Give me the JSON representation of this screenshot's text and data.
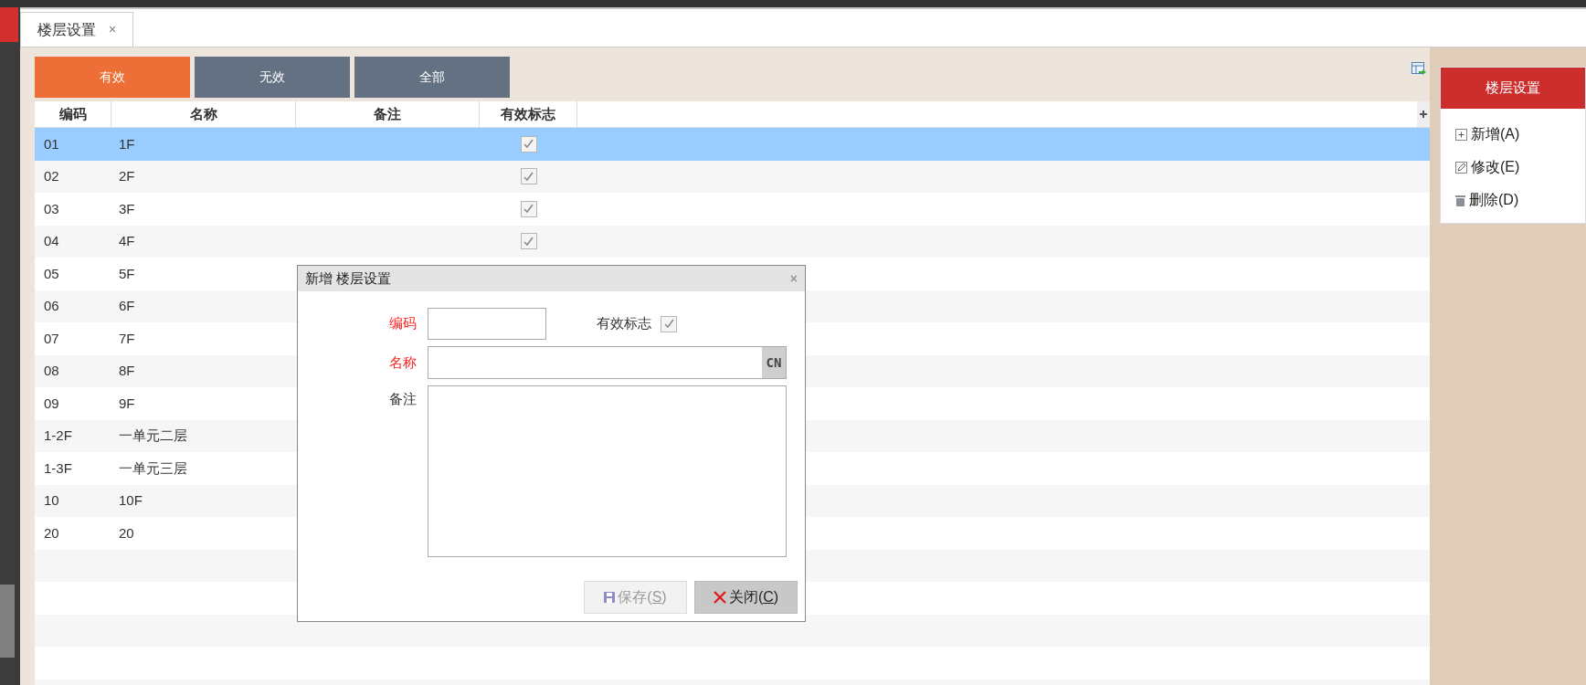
{
  "tab": {
    "label": "楼层设置",
    "close": "×"
  },
  "filters": [
    {
      "label": "有效",
      "selected": true
    },
    {
      "label": "无效",
      "selected": false
    },
    {
      "label": "全部",
      "selected": false
    }
  ],
  "table": {
    "columns": [
      "编码",
      "名称",
      "备注",
      "有效标志"
    ],
    "rows": [
      {
        "code": "01",
        "name": "1F",
        "selected": true,
        "valid": true
      },
      {
        "code": "02",
        "name": "2F",
        "selected": false,
        "valid": true
      },
      {
        "code": "03",
        "name": "3F",
        "selected": false,
        "valid": true
      },
      {
        "code": "04",
        "name": "4F",
        "selected": false,
        "valid": true
      },
      {
        "code": "05",
        "name": "5F",
        "selected": false
      },
      {
        "code": "06",
        "name": "6F",
        "selected": false
      },
      {
        "code": "07",
        "name": "7F",
        "selected": false
      },
      {
        "code": "08",
        "name": "8F",
        "selected": false
      },
      {
        "code": "09",
        "name": "9F",
        "selected": false
      },
      {
        "code": "1-2F",
        "name": "一单元二层",
        "selected": false
      },
      {
        "code": "1-3F",
        "name": "一单元三层",
        "selected": false
      },
      {
        "code": "10",
        "name": "10F",
        "selected": false
      },
      {
        "code": "20",
        "name": "20",
        "selected": false
      }
    ]
  },
  "side_panel": {
    "title": "楼层设置",
    "items": [
      {
        "kind": "add",
        "label": "新增(A)"
      },
      {
        "kind": "edit",
        "label": "修改(E)"
      },
      {
        "kind": "delete",
        "label": "删除(D)"
      }
    ]
  },
  "dialog": {
    "title": "新增 楼层设置",
    "close": "×",
    "code_label": "编码",
    "valid_label": "有效标志",
    "valid_checked": true,
    "name_label": "名称",
    "name_suffix": "CN",
    "remark_label": "备注",
    "buttons": [
      {
        "kind": "save",
        "before": "保存(",
        "hotkey": "S",
        "after": ")",
        "disabled": true
      },
      {
        "kind": "close",
        "before": "关闭(",
        "hotkey": "C",
        "after": ")",
        "disabled": false
      }
    ]
  }
}
